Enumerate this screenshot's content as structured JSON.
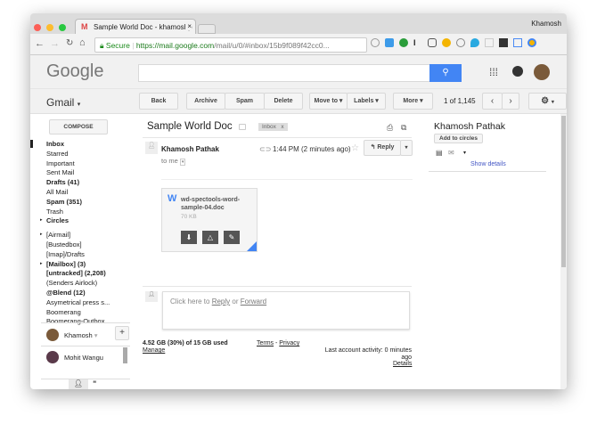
{
  "browser": {
    "tab_title": "Sample World Doc - khamoshp",
    "user": "Khamosh",
    "secure": "Secure",
    "url_host": "https://mail.google.com",
    "url_path": "/mail/u/0/#inbox/15b9f089f42cc0..."
  },
  "header": {
    "logo": "Google",
    "app": "Gmail"
  },
  "toolbar": {
    "back": "Back",
    "archive": "Archive",
    "spam": "Spam",
    "delete": "Delete",
    "move_to": "Move to",
    "labels": "Labels",
    "more": "More",
    "pager": "1 of 1,145"
  },
  "sidebar": {
    "compose": "COMPOSE",
    "items": [
      "Inbox",
      "Starred",
      "Important",
      "Sent Mail",
      "Drafts (41)",
      "All Mail",
      "Spam (351)",
      "Trash",
      "Circles",
      "[Airmail]",
      "[Bustedbox]",
      "[Imap]/Drafts",
      "[Mailbox] (3)",
      "[untracked] (2,208)",
      "(Senders Airlock)",
      "@Blend (12)",
      "Asymetrical press s...",
      "Boomerang",
      "Boomerang-Outbox"
    ]
  },
  "chat": {
    "me": "Khamosh",
    "contacts": [
      "Mohit Wangu"
    ]
  },
  "email": {
    "subject": "Sample World Doc",
    "label": "Inbox",
    "sender": "Khamosh Pathak",
    "time": "1:44 PM (2 minutes ago)",
    "reply": "Reply",
    "to": "to me",
    "attachment": {
      "name1": "wd-spectools-word-",
      "name2": "sample-04.doc",
      "size": "70 KB"
    },
    "reply_prompt": "Click here to",
    "reply_link": "Reply",
    "or": "or",
    "forward_link": "Forward"
  },
  "contact_card": {
    "name": "Khamosh Pathak",
    "add": "Add to circles",
    "details": "Show details"
  },
  "footer": {
    "storage": "4.52 GB (30%) of 15 GB used",
    "manage": "Manage",
    "terms": "Terms",
    "sep": " - ",
    "privacy": "Privacy",
    "activity": "Last account activity: 0 minutes ago",
    "details": "Details"
  }
}
